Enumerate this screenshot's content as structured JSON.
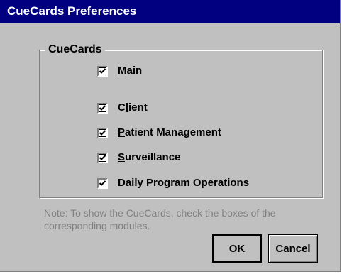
{
  "window": {
    "title": "CueCards Preferences"
  },
  "group": {
    "label": "CueCards"
  },
  "checkboxes": [
    {
      "label": "Main",
      "accel": "M",
      "rest": "ain",
      "checked": true
    },
    {
      "label": "Client",
      "accel": "l",
      "pre": "C",
      "rest": "ient",
      "checked": true
    },
    {
      "label": "Patient Management",
      "accel": "P",
      "rest": "atient Management",
      "checked": true
    },
    {
      "label": "Surveillance",
      "accel": "S",
      "rest": "urveillance",
      "checked": true
    },
    {
      "label": "Daily Program Operations",
      "accel": "D",
      "rest": "aily Program Operations",
      "checked": true
    }
  ],
  "note": "Note:  To show the CueCards, check the boxes of the corresponding modules.",
  "buttons": {
    "ok": {
      "accel": "O",
      "rest": "K"
    },
    "cancel": {
      "accel": "C",
      "rest": "ancel"
    }
  },
  "colors": {
    "titlebar": "#000080",
    "face": "#c0c0c0",
    "disabled_text": "#808080"
  }
}
